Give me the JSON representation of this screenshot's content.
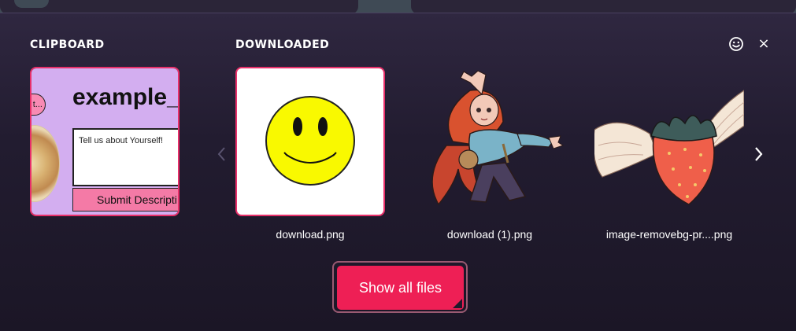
{
  "sections": {
    "clipboard_heading": "CLIPBOARD",
    "downloaded_heading": "DOWNLOADED"
  },
  "header_icons": [
    "smiley-icon",
    "close-icon"
  ],
  "close_label": "×",
  "clipboard_item": {
    "pill_text": "t...",
    "title": "example_",
    "textarea_text": "Tell us about Yourself!",
    "submit_label": "Submit Descripti"
  },
  "downloaded_files": [
    {
      "name": "download.png",
      "selected": true
    },
    {
      "name": "download (1).png",
      "selected": false
    },
    {
      "name": "image-removebg-pr....png",
      "selected": false
    }
  ],
  "nav": {
    "prev_icon": "chevron-left-icon",
    "next_icon": "chevron-right-icon"
  },
  "show_all_label": "Show all files",
  "colors": {
    "accent": "#ee1f55",
    "selected_border": "#e8306a",
    "background": "#1f1a2b",
    "text": "#ffffff"
  }
}
